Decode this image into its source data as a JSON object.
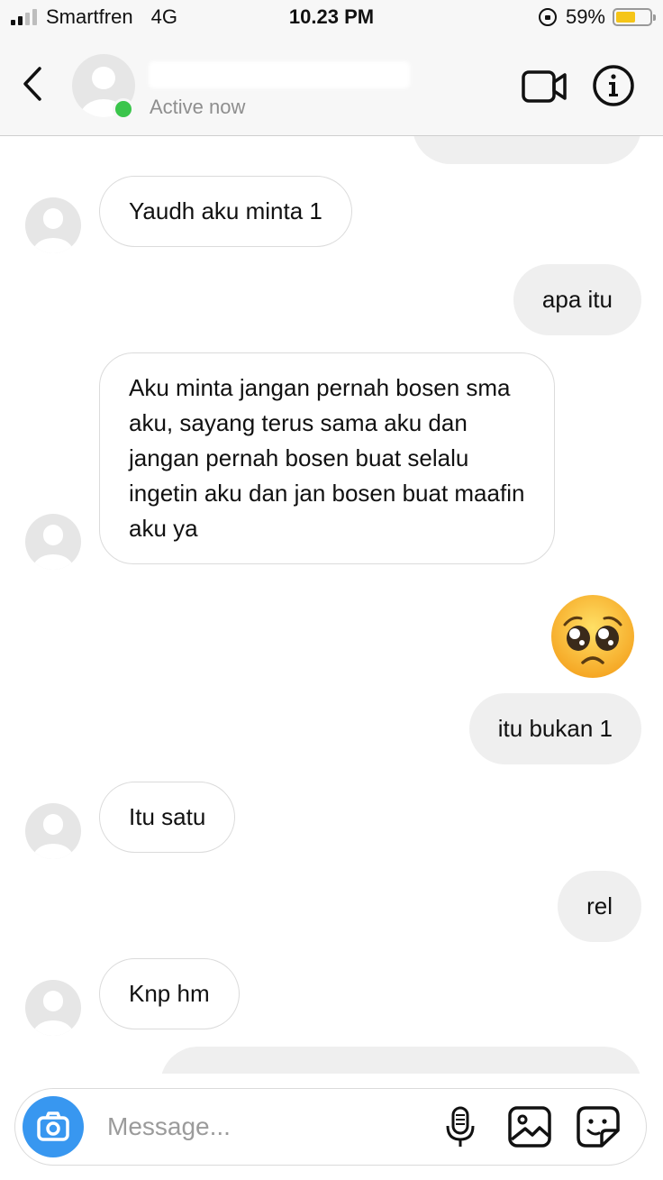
{
  "status_bar": {
    "carrier": "Smartfren",
    "network": "4G",
    "time": "10.23 PM",
    "battery": "59%",
    "battery_level": 0.59,
    "signal_bars": 2
  },
  "header": {
    "presence": "Active now",
    "colors": {
      "online": "#3ac54b"
    }
  },
  "messages": [
    {
      "side": "outgoing",
      "text": ""
    },
    {
      "side": "incoming",
      "text": "Yaudh aku minta 1"
    },
    {
      "side": "outgoing",
      "text": "apa itu"
    },
    {
      "side": "incoming",
      "text": "Aku minta jangan pernah bosen sma aku, sayang terus sama aku dan jangan pernah bosen buat selalu ingetin aku dan jan bosen buat maafin aku ya"
    },
    {
      "side": "outgoing",
      "type": "emoji",
      "emoji": "pleading-face"
    },
    {
      "side": "outgoing",
      "text": "itu bukan 1"
    },
    {
      "side": "incoming",
      "text": "Itu satu"
    },
    {
      "side": "outgoing",
      "text": "rel"
    },
    {
      "side": "incoming",
      "text": "Knp hm"
    },
    {
      "side": "outgoing",
      "text": ""
    }
  ],
  "composer": {
    "placeholder": "Message...",
    "colors": {
      "camera": "#3897f0"
    }
  }
}
